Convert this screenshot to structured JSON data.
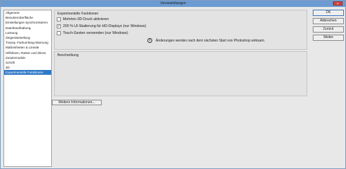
{
  "window": {
    "title": "Voreinstellungen",
    "close_label": "×"
  },
  "sidebar": {
    "items": [
      {
        "label": "Allgemein"
      },
      {
        "label": "Benutzeroberfläche"
      },
      {
        "label": "Einstellungen synchronisieren"
      },
      {
        "label": "Dateihandhabung"
      },
      {
        "label": "Leistung"
      },
      {
        "label": "Zeigerdarstellung"
      },
      {
        "label": "Transp.-Farbumfang-Warnung"
      },
      {
        "label": "Maßeinheiten & Lineale"
      },
      {
        "label": "Hilfslinien, Raster und Slices"
      },
      {
        "label": "Zusatzmodule"
      },
      {
        "label": "Schrift"
      },
      {
        "label": "3D"
      },
      {
        "label": "Experimentelle Funktionen",
        "selected": true
      }
    ]
  },
  "experimental": {
    "title": "Experimentelle Funktionen",
    "options": [
      {
        "label": "Mehrton-3D-Druck aktivieren",
        "checked": false
      },
      {
        "label": "200 % UI-Skalierung für HD-Displays (nur Windows)",
        "checked": true
      },
      {
        "label": "Touch-Gesten verwenden (nur Windows)",
        "checked": false
      }
    ],
    "info_text": "Änderungen werden nach dem nächsten Start von Photoshop wirksam."
  },
  "description": {
    "title": "Beschreibung"
  },
  "more_info_button": "Weitere Informationen...",
  "buttons": {
    "ok": "OK",
    "cancel": "Abbrechen",
    "back": "Zurück",
    "next": "Weiter"
  },
  "colors": {
    "selection": "#2f78c8",
    "titlebar": "#6c9bd2",
    "close": "#c9463d"
  }
}
